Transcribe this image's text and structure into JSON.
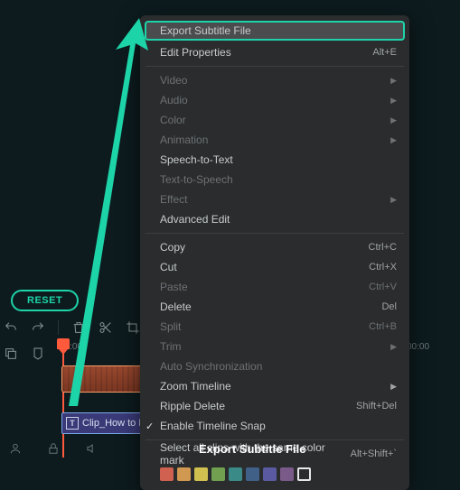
{
  "reset_label": "RESET",
  "timeline": {
    "ticks": [
      "00:00",
      "00:00"
    ],
    "text_clip_label": "Clip_How to B"
  },
  "menu": {
    "items": [
      {
        "label": "Export Subtitle File",
        "enabled": true,
        "highlighted": true
      },
      {
        "label": "Edit Properties",
        "enabled": true,
        "shortcut": "Alt+E"
      },
      {
        "sep": true
      },
      {
        "label": "Video",
        "enabled": false,
        "submenu": true
      },
      {
        "label": "Audio",
        "enabled": false,
        "submenu": true
      },
      {
        "label": "Color",
        "enabled": false,
        "submenu": true
      },
      {
        "label": "Animation",
        "enabled": false,
        "submenu": true
      },
      {
        "label": "Speech-to-Text",
        "enabled": true
      },
      {
        "label": "Text-to-Speech",
        "enabled": false
      },
      {
        "label": "Effect",
        "enabled": false,
        "submenu": true
      },
      {
        "label": "Advanced Edit",
        "enabled": true
      },
      {
        "sep": true
      },
      {
        "label": "Copy",
        "enabled": true,
        "shortcut": "Ctrl+C"
      },
      {
        "label": "Cut",
        "enabled": true,
        "shortcut": "Ctrl+X"
      },
      {
        "label": "Paste",
        "enabled": false,
        "shortcut": "Ctrl+V"
      },
      {
        "label": "Delete",
        "enabled": true,
        "shortcut": "Del"
      },
      {
        "label": "Split",
        "enabled": false,
        "shortcut": "Ctrl+B"
      },
      {
        "label": "Trim",
        "enabled": false,
        "submenu": true
      },
      {
        "label": "Auto Synchronization",
        "enabled": false
      },
      {
        "label": "Zoom Timeline",
        "enabled": true,
        "submenu": true
      },
      {
        "label": "Ripple Delete",
        "enabled": true,
        "shortcut": "Shift+Del"
      },
      {
        "label": "Enable Timeline Snap",
        "enabled": true,
        "checked": true
      },
      {
        "sep": true
      },
      {
        "label": "Select all clips with the same color mark",
        "enabled": true,
        "shortcut": "Alt+Shift+`"
      }
    ],
    "colors": [
      "#d06050",
      "#d09850",
      "#d0c050",
      "#70a050",
      "#3a8a88",
      "#406088",
      "#5a5aa0",
      "#7a5a88",
      "outline"
    ]
  },
  "tooltip": "Export Subtitle File"
}
